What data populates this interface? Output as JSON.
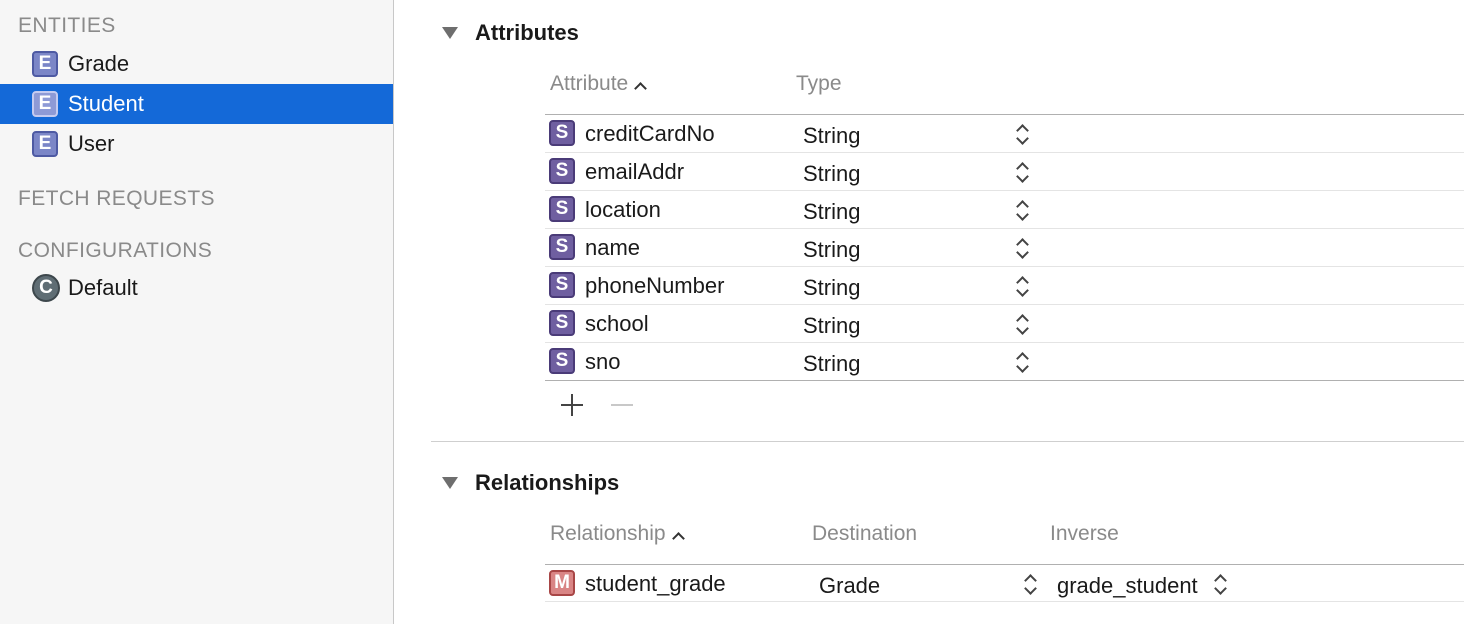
{
  "sidebar": {
    "entities_header": "ENTITIES",
    "entities": [
      {
        "badge": "E",
        "label": "Grade",
        "selected": false
      },
      {
        "badge": "E",
        "label": "Student",
        "selected": true
      },
      {
        "badge": "E",
        "label": "User",
        "selected": false
      }
    ],
    "fetch_requests_header": "FETCH REQUESTS",
    "configurations_header": "CONFIGURATIONS",
    "configurations": [
      {
        "badge": "C",
        "label": "Default"
      }
    ]
  },
  "attributes": {
    "title": "Attributes",
    "col_attribute": "Attribute",
    "col_type": "Type",
    "rows": [
      {
        "badge": "S",
        "name": "creditCardNo",
        "type": "String"
      },
      {
        "badge": "S",
        "name": "emailAddr",
        "type": "String"
      },
      {
        "badge": "S",
        "name": "location",
        "type": "String"
      },
      {
        "badge": "S",
        "name": "name",
        "type": "String"
      },
      {
        "badge": "S",
        "name": "phoneNumber",
        "type": "String"
      },
      {
        "badge": "S",
        "name": "school",
        "type": "String"
      },
      {
        "badge": "S",
        "name": "sno",
        "type": "String"
      }
    ]
  },
  "relationships": {
    "title": "Relationships",
    "col_relationship": "Relationship",
    "col_destination": "Destination",
    "col_inverse": "Inverse",
    "rows": [
      {
        "badge": "M",
        "name": "student_grade",
        "destination": "Grade",
        "inverse": "grade_student"
      }
    ]
  },
  "colors": {
    "selection": "#1469d8",
    "entity_badge": "#7b86c7",
    "string_badge": "#6f5fa0",
    "relationship_badge": "#d98585"
  }
}
